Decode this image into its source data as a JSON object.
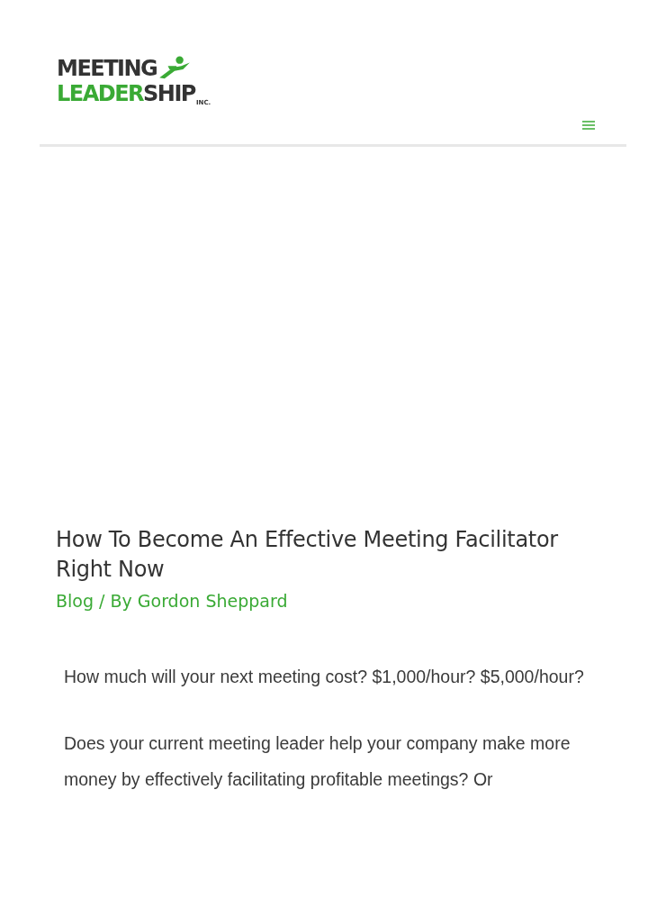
{
  "header": {
    "logo": {
      "line_1": "MEETING",
      "line_2_first": "LEADER",
      "line_2_second": "SHIP",
      "suffix": "INC."
    }
  },
  "article": {
    "title": "How To Become An Effective Meeting Facilitator Right Now",
    "meta": "Blog / By Gordon Sheppard",
    "paragraphs": [
      "How much will your next meeting cost? $1,000/hour? $5,000/hour?",
      "Does your current meeting leader help your company make more money by effectively facilitating profitable meetings? Or"
    ]
  }
}
